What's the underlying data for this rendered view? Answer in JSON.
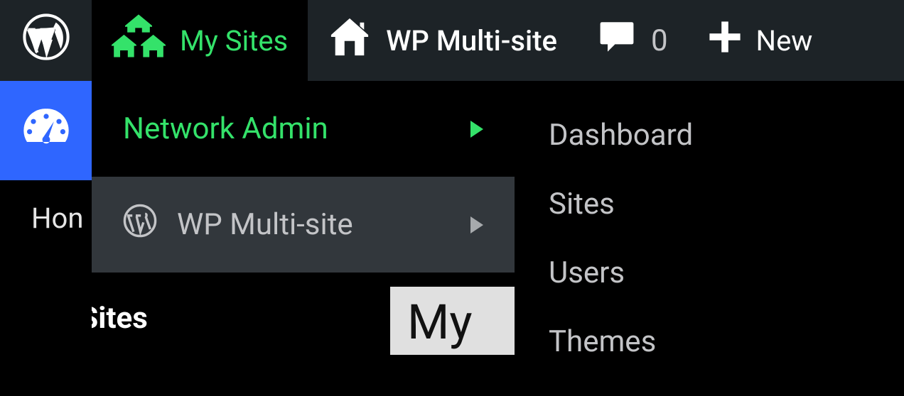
{
  "adminbar": {
    "my_sites": "My Sites",
    "site_name": "WP Multi-site",
    "comments_count": "0",
    "new": "New"
  },
  "sidebar": {
    "home_label": "Hon"
  },
  "dropdown": {
    "network_admin": "Network Admin",
    "site_item": "WP Multi-site"
  },
  "submenu": {
    "items": [
      "Dashboard",
      "Sites",
      "Users",
      "Themes"
    ]
  },
  "content": {
    "my_sites": "My Sites",
    "truncated": "My"
  },
  "colors": {
    "accent": "#34e26a",
    "sidebar_active": "#2f66ff",
    "bar": "#1d2327",
    "hover": "#32373c"
  }
}
